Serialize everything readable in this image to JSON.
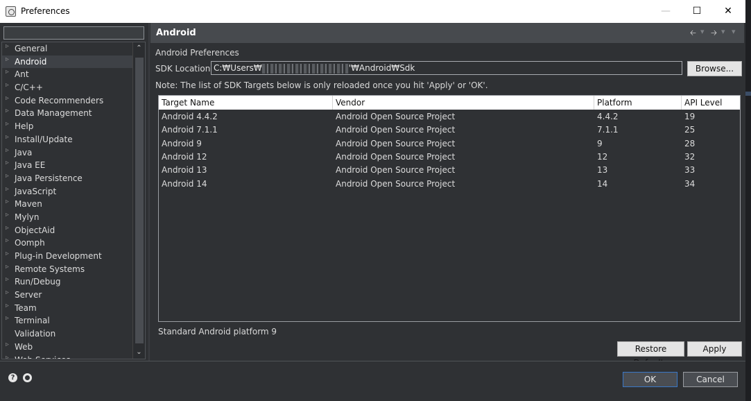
{
  "window": {
    "title": "Preferences",
    "minimize": "—",
    "maximize": "☐",
    "close": "✕"
  },
  "filter": {
    "placeholder": "",
    "value": ""
  },
  "tree": {
    "items": [
      {
        "label": "General",
        "expandable": true
      },
      {
        "label": "Android",
        "expandable": true,
        "selected": true
      },
      {
        "label": "Ant",
        "expandable": true
      },
      {
        "label": "C/C++",
        "expandable": true
      },
      {
        "label": "Code Recommenders",
        "expandable": true
      },
      {
        "label": "Data Management",
        "expandable": true
      },
      {
        "label": "Help",
        "expandable": true
      },
      {
        "label": "Install/Update",
        "expandable": true
      },
      {
        "label": "Java",
        "expandable": true
      },
      {
        "label": "Java EE",
        "expandable": true
      },
      {
        "label": "Java Persistence",
        "expandable": true
      },
      {
        "label": "JavaScript",
        "expandable": true
      },
      {
        "label": "Maven",
        "expandable": true
      },
      {
        "label": "Mylyn",
        "expandable": true
      },
      {
        "label": "ObjectAid",
        "expandable": true
      },
      {
        "label": "Oomph",
        "expandable": true
      },
      {
        "label": "Plug-in Development",
        "expandable": true
      },
      {
        "label": "Remote Systems",
        "expandable": true
      },
      {
        "label": "Run/Debug",
        "expandable": true
      },
      {
        "label": "Server",
        "expandable": true
      },
      {
        "label": "Team",
        "expandable": true
      },
      {
        "label": "Terminal",
        "expandable": true
      },
      {
        "label": "Validation",
        "expandable": false
      },
      {
        "label": "Web",
        "expandable": true
      },
      {
        "label": "Web Services",
        "expandable": true
      }
    ]
  },
  "page": {
    "title": "Android",
    "section_label": "Android Preferences",
    "sdk_label": "SDK Location:",
    "sdk_prefix": "C:₩Users₩",
    "sdk_suffix": "'₩Android₩Sdk",
    "browse": "Browse...",
    "note": "Note: The list of SDK Targets below is only reloaded once you hit 'Apply' or 'OK'.",
    "columns": [
      "Target Name",
      "Vendor",
      "Platform",
      "API Level"
    ],
    "rows": [
      [
        "Android 4.4.2",
        "Android Open Source Project",
        "4.4.2",
        "19"
      ],
      [
        "Android 7.1.1",
        "Android Open Source Project",
        "7.1.1",
        "25"
      ],
      [
        "Android 9",
        "Android Open Source Project",
        "9",
        "28"
      ],
      [
        "Android 12",
        "Android Open Source Project",
        "12",
        "32"
      ],
      [
        "Android 13",
        "Android Open Source Project",
        "13",
        "33"
      ],
      [
        "Android 14",
        "Android Open Source Project",
        "14",
        "34"
      ]
    ],
    "status": "Standard Android platform 9",
    "restore_defaults": "Restore Defaults",
    "apply": "Apply"
  },
  "footer": {
    "ok": "OK",
    "cancel": "Cancel",
    "help_glyph": "?"
  },
  "colors": {
    "accent": "#3a78c7",
    "background": "#2f3134",
    "header": "#474a4e"
  }
}
